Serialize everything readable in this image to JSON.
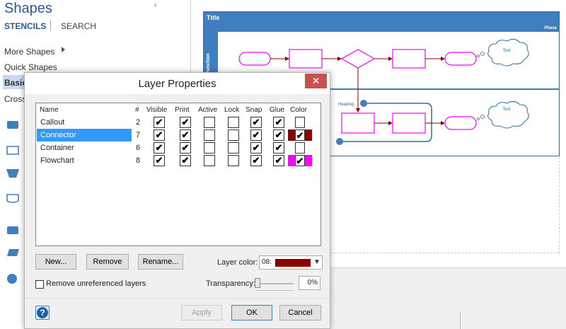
{
  "shapes_pane": {
    "title": "Shapes",
    "collapse_glyph": "‹",
    "tabs": [
      "STENCILS",
      "SEARCH"
    ],
    "items": [
      "More Shapes",
      "Quick Shapes",
      "Basic",
      "Cross"
    ]
  },
  "diagram": {
    "title": "Title",
    "phase": "Phase",
    "function": "Function",
    "heading": "Heading",
    "cloud_text_1": "Text",
    "cloud_text_2": "Text",
    "connector_color": "#8b0000",
    "flowchart_color": "#ff00ff",
    "container_color": "#2e6da4"
  },
  "dialog": {
    "title": "Layer Properties",
    "close_glyph": "✕",
    "columns": [
      "Name",
      "#",
      "Visible",
      "Print",
      "Active",
      "Lock",
      "Snap",
      "Glue",
      "Color"
    ],
    "layers": [
      {
        "name": "Callout",
        "count": "2",
        "visible": true,
        "print": true,
        "active": false,
        "lock": false,
        "snap": true,
        "glue": true,
        "color": null,
        "color_checked": false,
        "selected": false
      },
      {
        "name": "Connector",
        "count": "7",
        "visible": true,
        "print": true,
        "active": false,
        "lock": false,
        "snap": true,
        "glue": true,
        "color": "#8b0000",
        "color_checked": true,
        "selected": true
      },
      {
        "name": "Container",
        "count": "6",
        "visible": true,
        "print": true,
        "active": false,
        "lock": false,
        "snap": true,
        "glue": true,
        "color": null,
        "color_checked": false,
        "selected": false
      },
      {
        "name": "Flowchart",
        "count": "8",
        "visible": true,
        "print": true,
        "active": false,
        "lock": false,
        "snap": true,
        "glue": true,
        "color": "#ff00ff",
        "color_checked": true,
        "selected": false
      }
    ],
    "buttons": {
      "new": "New...",
      "remove": "Remove",
      "rename": "Rename...",
      "apply": "Apply",
      "ok": "OK",
      "cancel": "Cancel"
    },
    "layer_color_label": "Layer color:",
    "layer_color_code": "08:",
    "layer_color_value": "#8b0000",
    "remove_unreferenced_label": "Remove unreferenced layers",
    "remove_unreferenced_checked": false,
    "transparency_label": "Transparency:",
    "transparency_value": "0%",
    "help_glyph": "?"
  }
}
